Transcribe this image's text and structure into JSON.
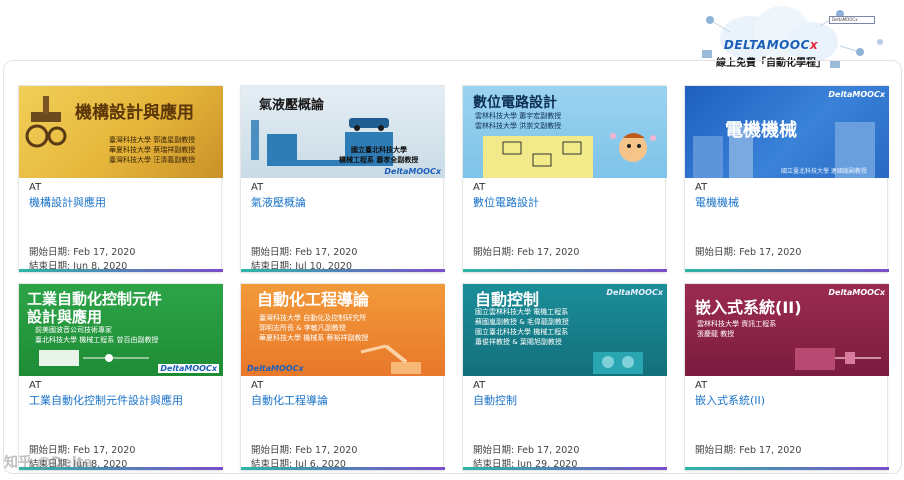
{
  "header": {
    "brand_logo_text": "DELTAMOOCx",
    "brand_tagline": "線上免費「自動化學程」",
    "search_box_text": "DeltaMOOCx"
  },
  "courses": [
    {
      "org": "AT",
      "title": "機構設計與應用",
      "start": "開始日期: Feb 17, 2020",
      "end": "結束日期: Jun 8, 2020",
      "thumb_title": "機構設計與應用",
      "thumb_lines": [
        "臺灣科技大學  郭進星副教授",
        "華夏科技大學  蔡瑞祥副教授",
        "臺灣科技大學  汪清義副教授"
      ]
    },
    {
      "org": "AT",
      "title": "氣液壓概論",
      "start": "開始日期: Feb 17, 2020",
      "end": "結束日期: Jul 10, 2020",
      "thumb_title": "氣液壓概論",
      "thumb_lines": [
        "國立臺北科技大學",
        "機械工程系  蕭孝全副教授"
      ]
    },
    {
      "org": "AT",
      "title": "數位電路設計",
      "start": "開始日期: Feb 17, 2020",
      "end": "",
      "thumb_title": "數位電路設計",
      "thumb_lines": [
        "雲林科技大學  蕭宇宏副教授",
        "雲林科技大學  洪崇文副教授"
      ]
    },
    {
      "org": "AT",
      "title": "電機機械",
      "start": "開始日期: Feb 17, 2020",
      "end": "",
      "thumb_title": "電機機械",
      "thumb_lines": [
        "國立臺北科技大學 連國龍副教授"
      ]
    },
    {
      "org": "AT",
      "title": "工業自動化控制元件設計與應用",
      "start": "開始日期: Feb 17, 2020",
      "end": "結束日期: Jun 8, 2020",
      "thumb_title": "工業自動化控制元件",
      "thumb_title2": "設計與應用",
      "thumb_lines": [
        "前美國波音公司技術專家",
        "臺北科技大學  機械工程系  曾百由副教授"
      ]
    },
    {
      "org": "AT",
      "title": "自動化工程導論",
      "start": "開始日期: Feb 17, 2020",
      "end": "結束日期: Jul 6, 2020",
      "thumb_title": "自動化工程導論",
      "thumb_lines": [
        "臺灣科技大學  自動化及控制研究所",
        "郭明志所長 & 李敏凡副教授",
        "華夏科技大學  機械系  蔡裕祥副教授"
      ]
    },
    {
      "org": "AT",
      "title": "自動控制",
      "start": "開始日期: Feb 17, 2020",
      "end": "結束日期: Jun 29, 2020",
      "thumb_title": "自動控制",
      "thumb_lines": [
        "國立雲林科技大學  電機工程系",
        "蘇國嵐副教授 & 毛偉龍副教授",
        "國立臺北科技大學  機械工程系",
        "蕭俊祥教授 & 葉賜旭副教授"
      ]
    },
    {
      "org": "AT",
      "title": "嵌入式系統(II)",
      "start": "開始日期: Feb 17, 2020",
      "end": "",
      "thumb_title": "嵌入式系統(II)",
      "thumb_lines": [
        "雲林科技大學  資訊工程系",
        "張慶龍  教授"
      ]
    }
  ],
  "thumb_brand": "DeltaMOOCx",
  "watermark_text": "知乎 @Delta"
}
